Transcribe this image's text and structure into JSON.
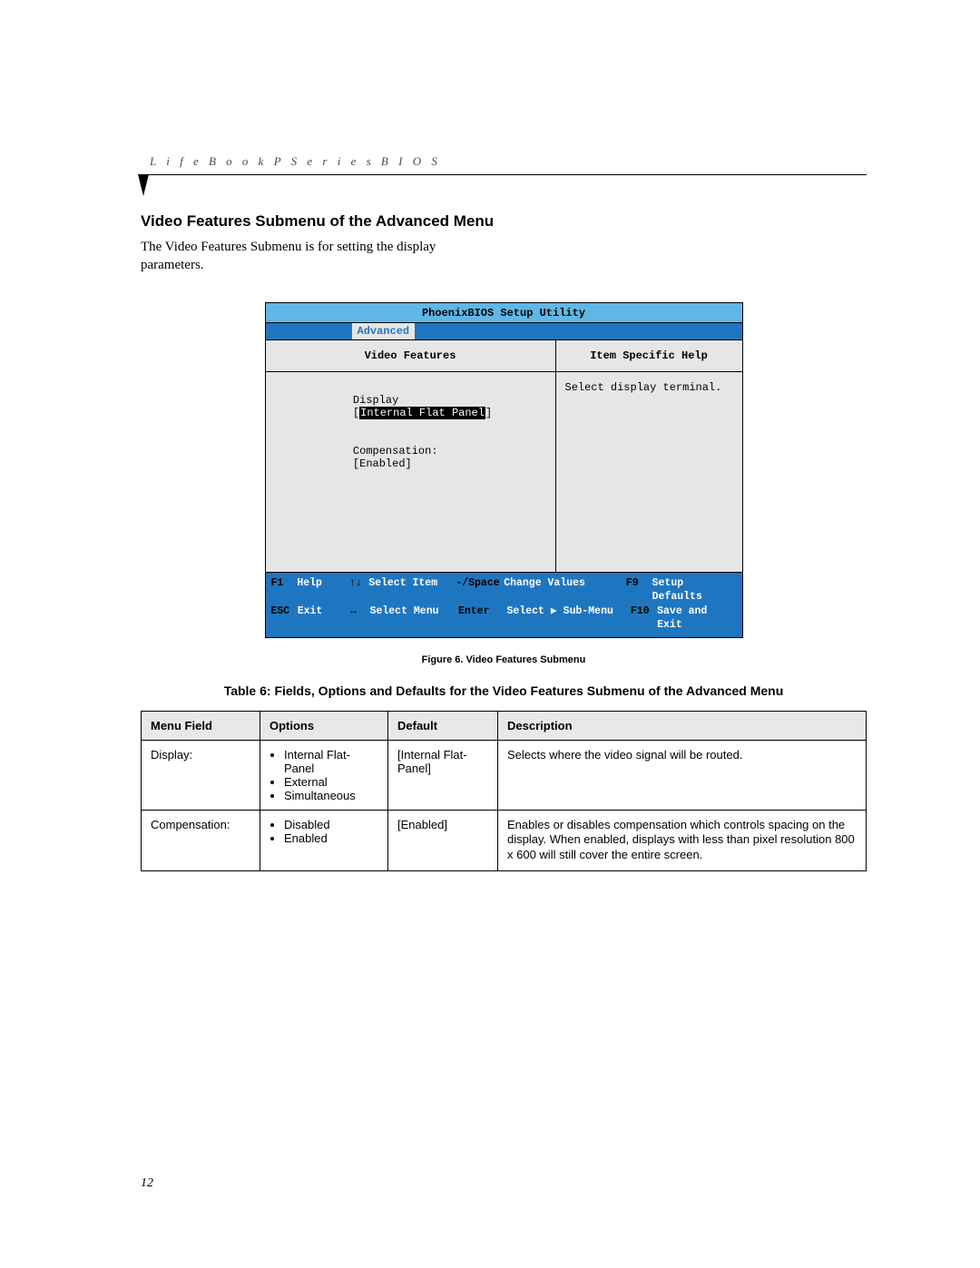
{
  "running_head": "L i f e B o o k   P   S e r i e s   B I O S",
  "section_title": "Video Features Submenu of the Advanced Menu",
  "intro_text": "The Video Features Submenu is for setting the display parameters.",
  "bios": {
    "title": "PhoenixBIOS Setup Utility",
    "active_tab": "Advanced",
    "left_title": "Video Features",
    "right_title": "Item Specific Help",
    "help_text": "Select display terminal.",
    "settings": [
      {
        "label": "Display",
        "value": "Internal Flat Panel",
        "highlight": true
      },
      {
        "label": "Compensation:",
        "value": "Enabled",
        "highlight": false
      }
    ],
    "footer": {
      "row1": {
        "k1": "F1",
        "v1": "Help",
        "k2": "↑↓",
        "v2": "Select Item",
        "k3": "-/Space",
        "v3": "Change Values",
        "k4": "F9",
        "v4": "Setup Defaults"
      },
      "row2": {
        "k1": "ESC",
        "v1": "Exit",
        "k2": "↔",
        "v2": "Select Menu",
        "k3": "Enter",
        "v3": "Select ▶ Sub-Menu",
        "k4": "F10",
        "v4": "Save and Exit"
      }
    }
  },
  "figure_caption": "Figure 6.  Video Features Submenu",
  "table_caption": "Table 6: Fields, Options and Defaults for the Video Features Submenu of the Advanced Menu",
  "table": {
    "headers": [
      "Menu Field",
      "Options",
      "Default",
      "Description"
    ],
    "rows": [
      {
        "field": "Display:",
        "options": [
          "Internal Flat-Panel",
          "External",
          "Simultaneous"
        ],
        "default": "[Internal Flat-Panel]",
        "description": "Selects where the video signal will be routed."
      },
      {
        "field": "Compensation:",
        "options": [
          "Disabled",
          "Enabled"
        ],
        "default": "[Enabled]",
        "description": "Enables or disables compensation which controls spacing on the display. When enabled, displays with less than pixel resolution 800 x 600 will still cover the entire screen."
      }
    ]
  },
  "page_number": "12"
}
